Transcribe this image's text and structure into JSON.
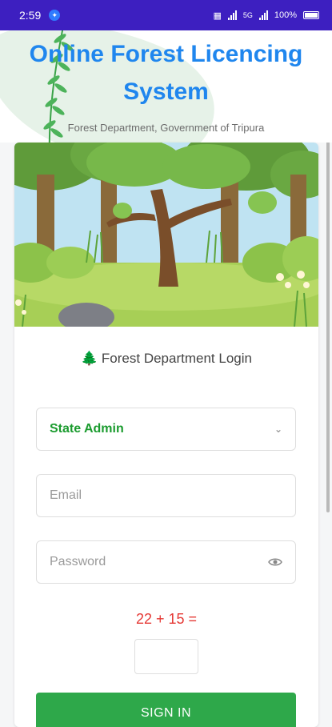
{
  "status_bar": {
    "time": "2:59",
    "notification_icon": "app-notification-icon",
    "network": "5G",
    "battery_percent": "100%"
  },
  "header": {
    "title": "Online Forest Licencing System",
    "subtitle": "Forest Department, Government of Tripura"
  },
  "login": {
    "heading_icon": "🌲",
    "heading": "Forest Department Login",
    "role_selected": "State Admin",
    "email_placeholder": "Email",
    "password_placeholder": "Password",
    "captcha_question": "22 + 15 =",
    "captcha_value": "",
    "sign_in_label": "SIGN IN"
  },
  "colors": {
    "status_bar": "#3d1fc0",
    "title": "#1f86ee",
    "accent_green": "#2ea84a",
    "captcha_red": "#e53935"
  }
}
